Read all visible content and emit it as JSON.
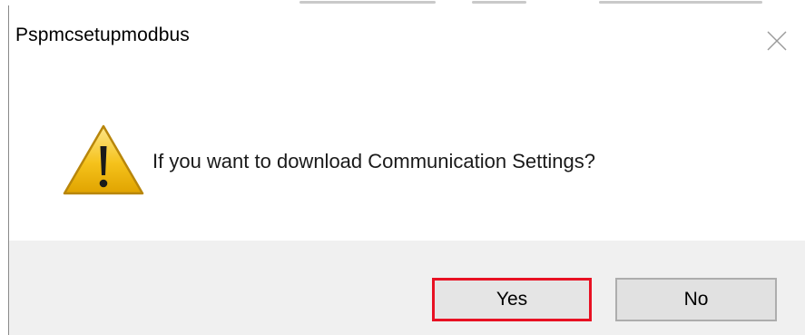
{
  "dialog": {
    "title": "Pspmcsetupmodbus",
    "close_icon": "close-icon",
    "message": "If you want to download Communication Settings?",
    "icon": "warning-icon"
  },
  "buttons": {
    "yes_label": "Yes",
    "no_label": "No"
  },
  "colors": {
    "highlight_border": "#e81123",
    "footer_bg": "#f0f0f0",
    "button_bg": "#e1e1e1",
    "warning_yellow": "#f5c21b"
  }
}
